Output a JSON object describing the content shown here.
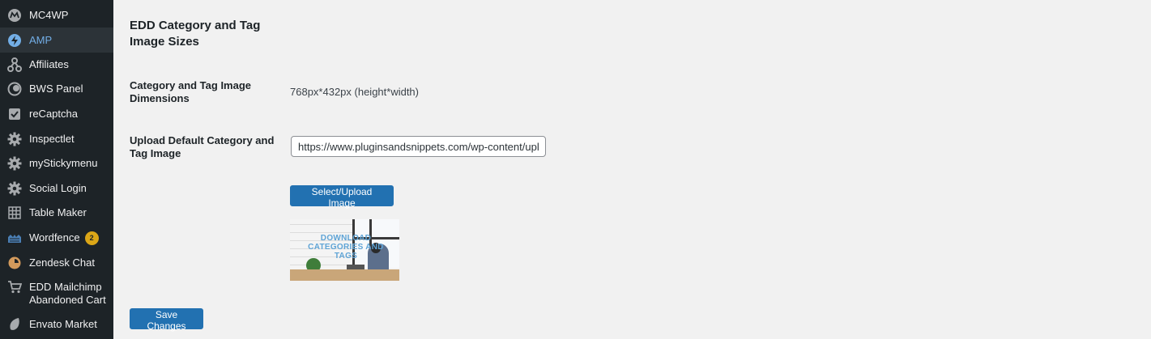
{
  "sidebar": {
    "items": [
      {
        "label": "MC4WP",
        "icon": "mc4wp-icon"
      },
      {
        "label": "AMP",
        "icon": "amp-bolt-icon"
      },
      {
        "label": "Affiliates",
        "icon": "affiliates-icon"
      },
      {
        "label": "BWS Panel",
        "icon": "bws-panel-icon"
      },
      {
        "label": "reCaptcha",
        "icon": "recaptcha-check-icon"
      },
      {
        "label": "Inspectlet",
        "icon": "gear-icon"
      },
      {
        "label": "myStickymenu",
        "icon": "gear-icon"
      },
      {
        "label": "Social Login",
        "icon": "gear-icon"
      },
      {
        "label": "Table Maker",
        "icon": "table-grid-icon"
      },
      {
        "label": "Wordfence",
        "icon": "wordfence-icon",
        "badge": "2"
      },
      {
        "label": "Zendesk Chat",
        "icon": "zendesk-chat-icon"
      },
      {
        "label": "EDD Mailchimp Abandoned Cart",
        "icon": "cart-icon"
      },
      {
        "label": "Envato Market",
        "icon": "envato-leaf-icon"
      }
    ],
    "active_index": 1
  },
  "main": {
    "section_title": "EDD Category and Tag Image Sizes",
    "dimensions_label": "Category and Tag Image Dimensions",
    "dimensions_value": "768px*432px (height*width)",
    "upload_label": "Upload Default Category and Tag Image",
    "upload_url": "https://www.pluginsandsnippets.com/wp-content/uploads/",
    "upload_button": "Select/Upload Image",
    "preview_overlay": "DOWNLOAD CATEGORIES AND TAGS",
    "save_button": "Save Changes"
  },
  "colors": {
    "sidebar_bg": "#1d2327",
    "active_bg": "#2c3338",
    "active_text": "#72aee6",
    "button_primary": "#2271b1",
    "badge": "#dba617",
    "page_bg": "#f1f1f1"
  }
}
